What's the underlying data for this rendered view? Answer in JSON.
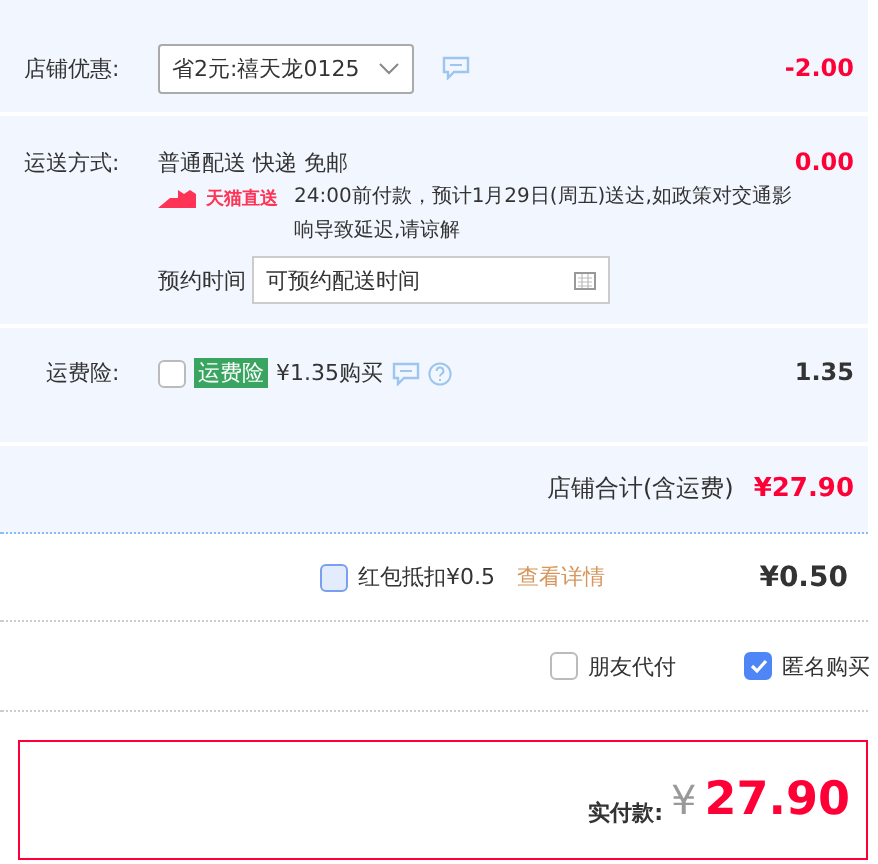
{
  "shop_discount": {
    "label": "店铺优惠:",
    "coupon": "省2元:禧天龙0125",
    "amount": "-2.00"
  },
  "shipping": {
    "label": "运送方式:",
    "method": "普通配送 快递 免邮",
    "amount": "0.00",
    "badge": "天猫直送",
    "notice": "24:00前付款，预计1月29日(周五)送达,如政策对交通影响导致延迟,请谅解",
    "schedule_label": "预约时间",
    "schedule_placeholder": "可预约配送时间"
  },
  "insurance": {
    "label": "运费险:",
    "checked": false,
    "tag": "运费险",
    "price": "¥1.35购买",
    "amount": "1.35"
  },
  "shop_total": {
    "label": "店铺合计(含运费)",
    "amount": "¥27.90"
  },
  "red_packet": {
    "checked": false,
    "label": "红包抵扣¥0.5",
    "link": "查看详情",
    "amount": "¥0.50"
  },
  "options": [
    {
      "label": "朋友代付",
      "checked": false
    },
    {
      "label": "匿名购买",
      "checked": true
    }
  ],
  "payment": {
    "label": "实付款:",
    "currency": "¥",
    "amount": "27.90"
  }
}
